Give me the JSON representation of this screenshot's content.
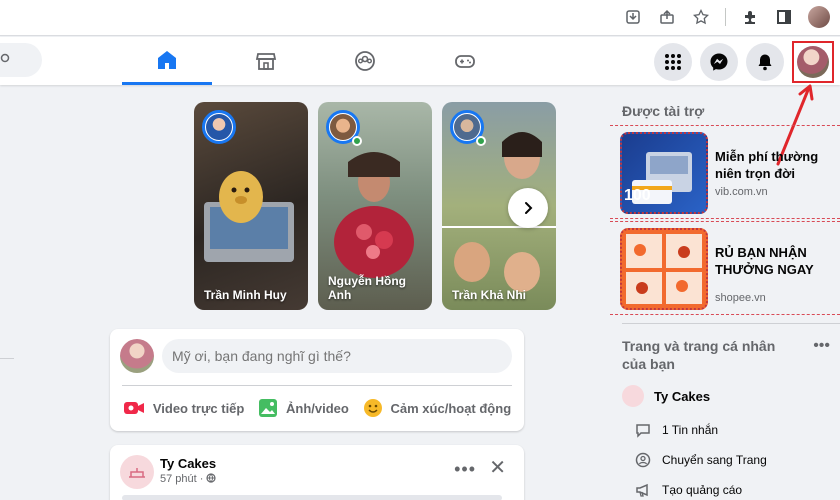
{
  "sidebar_right": {
    "sponsored_title": "Được tài trợ",
    "ads": [
      {
        "title": "Miễn phí thường niên trọn đời",
        "domain": "vib.com.vn",
        "thumb_label": "100"
      },
      {
        "title": "RỦ BẠN NHẬN THƯỞNG NGAY",
        "domain": "shopee.vn"
      }
    ],
    "pages_title": "Trang và trang cá nhân của bạn",
    "page_name": "Ty Cakes",
    "page_actions": [
      {
        "label": "1 Tin nhắn",
        "icon": "message-icon"
      },
      {
        "label": "Chuyển sang Trang",
        "icon": "switch-profile-icon"
      },
      {
        "label": "Tạo quảng cáo",
        "icon": "megaphone-icon"
      }
    ]
  },
  "stories": [
    {
      "name": "Trần Minh Huy"
    },
    {
      "name": "Nguyễn Hồng Anh"
    },
    {
      "name": "Trần Khả Nhi"
    }
  ],
  "composer": {
    "placeholder": "Mỹ ơi, bạn đang nghĩ gì thế?",
    "actions": [
      {
        "label": "Video trực tiếp",
        "icon": "live-video-icon",
        "color": "#f02849"
      },
      {
        "label": "Ảnh/video",
        "icon": "photo-icon",
        "color": "#45bd62"
      },
      {
        "label": "Cảm xúc/hoạt động",
        "icon": "feeling-icon",
        "color": "#f7b928"
      }
    ]
  },
  "post": {
    "author": "Ty Cakes",
    "time": "57 phút ·"
  },
  "colors": {
    "brand": "#1877f2",
    "annotation": "#e0262b"
  }
}
